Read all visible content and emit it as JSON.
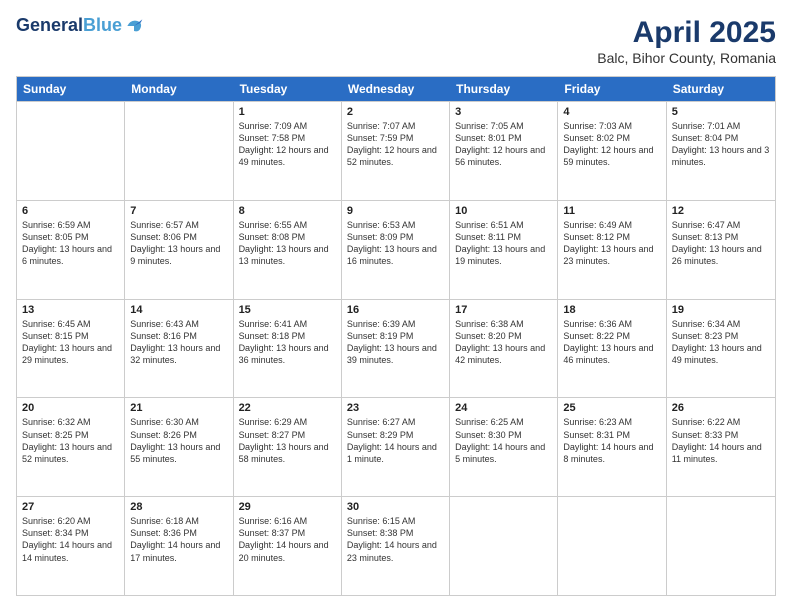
{
  "header": {
    "logo_line1": "General",
    "logo_line2": "Blue",
    "month_title": "April 2025",
    "location": "Balc, Bihor County, Romania"
  },
  "days_of_week": [
    "Sunday",
    "Monday",
    "Tuesday",
    "Wednesday",
    "Thursday",
    "Friday",
    "Saturday"
  ],
  "weeks": [
    [
      {
        "num": "",
        "sunrise": "",
        "sunset": "",
        "daylight": ""
      },
      {
        "num": "",
        "sunrise": "",
        "sunset": "",
        "daylight": ""
      },
      {
        "num": "1",
        "sunrise": "Sunrise: 7:09 AM",
        "sunset": "Sunset: 7:58 PM",
        "daylight": "Daylight: 12 hours and 49 minutes."
      },
      {
        "num": "2",
        "sunrise": "Sunrise: 7:07 AM",
        "sunset": "Sunset: 7:59 PM",
        "daylight": "Daylight: 12 hours and 52 minutes."
      },
      {
        "num": "3",
        "sunrise": "Sunrise: 7:05 AM",
        "sunset": "Sunset: 8:01 PM",
        "daylight": "Daylight: 12 hours and 56 minutes."
      },
      {
        "num": "4",
        "sunrise": "Sunrise: 7:03 AM",
        "sunset": "Sunset: 8:02 PM",
        "daylight": "Daylight: 12 hours and 59 minutes."
      },
      {
        "num": "5",
        "sunrise": "Sunrise: 7:01 AM",
        "sunset": "Sunset: 8:04 PM",
        "daylight": "Daylight: 13 hours and 3 minutes."
      }
    ],
    [
      {
        "num": "6",
        "sunrise": "Sunrise: 6:59 AM",
        "sunset": "Sunset: 8:05 PM",
        "daylight": "Daylight: 13 hours and 6 minutes."
      },
      {
        "num": "7",
        "sunrise": "Sunrise: 6:57 AM",
        "sunset": "Sunset: 8:06 PM",
        "daylight": "Daylight: 13 hours and 9 minutes."
      },
      {
        "num": "8",
        "sunrise": "Sunrise: 6:55 AM",
        "sunset": "Sunset: 8:08 PM",
        "daylight": "Daylight: 13 hours and 13 minutes."
      },
      {
        "num": "9",
        "sunrise": "Sunrise: 6:53 AM",
        "sunset": "Sunset: 8:09 PM",
        "daylight": "Daylight: 13 hours and 16 minutes."
      },
      {
        "num": "10",
        "sunrise": "Sunrise: 6:51 AM",
        "sunset": "Sunset: 8:11 PM",
        "daylight": "Daylight: 13 hours and 19 minutes."
      },
      {
        "num": "11",
        "sunrise": "Sunrise: 6:49 AM",
        "sunset": "Sunset: 8:12 PM",
        "daylight": "Daylight: 13 hours and 23 minutes."
      },
      {
        "num": "12",
        "sunrise": "Sunrise: 6:47 AM",
        "sunset": "Sunset: 8:13 PM",
        "daylight": "Daylight: 13 hours and 26 minutes."
      }
    ],
    [
      {
        "num": "13",
        "sunrise": "Sunrise: 6:45 AM",
        "sunset": "Sunset: 8:15 PM",
        "daylight": "Daylight: 13 hours and 29 minutes."
      },
      {
        "num": "14",
        "sunrise": "Sunrise: 6:43 AM",
        "sunset": "Sunset: 8:16 PM",
        "daylight": "Daylight: 13 hours and 32 minutes."
      },
      {
        "num": "15",
        "sunrise": "Sunrise: 6:41 AM",
        "sunset": "Sunset: 8:18 PM",
        "daylight": "Daylight: 13 hours and 36 minutes."
      },
      {
        "num": "16",
        "sunrise": "Sunrise: 6:39 AM",
        "sunset": "Sunset: 8:19 PM",
        "daylight": "Daylight: 13 hours and 39 minutes."
      },
      {
        "num": "17",
        "sunrise": "Sunrise: 6:38 AM",
        "sunset": "Sunset: 8:20 PM",
        "daylight": "Daylight: 13 hours and 42 minutes."
      },
      {
        "num": "18",
        "sunrise": "Sunrise: 6:36 AM",
        "sunset": "Sunset: 8:22 PM",
        "daylight": "Daylight: 13 hours and 46 minutes."
      },
      {
        "num": "19",
        "sunrise": "Sunrise: 6:34 AM",
        "sunset": "Sunset: 8:23 PM",
        "daylight": "Daylight: 13 hours and 49 minutes."
      }
    ],
    [
      {
        "num": "20",
        "sunrise": "Sunrise: 6:32 AM",
        "sunset": "Sunset: 8:25 PM",
        "daylight": "Daylight: 13 hours and 52 minutes."
      },
      {
        "num": "21",
        "sunrise": "Sunrise: 6:30 AM",
        "sunset": "Sunset: 8:26 PM",
        "daylight": "Daylight: 13 hours and 55 minutes."
      },
      {
        "num": "22",
        "sunrise": "Sunrise: 6:29 AM",
        "sunset": "Sunset: 8:27 PM",
        "daylight": "Daylight: 13 hours and 58 minutes."
      },
      {
        "num": "23",
        "sunrise": "Sunrise: 6:27 AM",
        "sunset": "Sunset: 8:29 PM",
        "daylight": "Daylight: 14 hours and 1 minute."
      },
      {
        "num": "24",
        "sunrise": "Sunrise: 6:25 AM",
        "sunset": "Sunset: 8:30 PM",
        "daylight": "Daylight: 14 hours and 5 minutes."
      },
      {
        "num": "25",
        "sunrise": "Sunrise: 6:23 AM",
        "sunset": "Sunset: 8:31 PM",
        "daylight": "Daylight: 14 hours and 8 minutes."
      },
      {
        "num": "26",
        "sunrise": "Sunrise: 6:22 AM",
        "sunset": "Sunset: 8:33 PM",
        "daylight": "Daylight: 14 hours and 11 minutes."
      }
    ],
    [
      {
        "num": "27",
        "sunrise": "Sunrise: 6:20 AM",
        "sunset": "Sunset: 8:34 PM",
        "daylight": "Daylight: 14 hours and 14 minutes."
      },
      {
        "num": "28",
        "sunrise": "Sunrise: 6:18 AM",
        "sunset": "Sunset: 8:36 PM",
        "daylight": "Daylight: 14 hours and 17 minutes."
      },
      {
        "num": "29",
        "sunrise": "Sunrise: 6:16 AM",
        "sunset": "Sunset: 8:37 PM",
        "daylight": "Daylight: 14 hours and 20 minutes."
      },
      {
        "num": "30",
        "sunrise": "Sunrise: 6:15 AM",
        "sunset": "Sunset: 8:38 PM",
        "daylight": "Daylight: 14 hours and 23 minutes."
      },
      {
        "num": "",
        "sunrise": "",
        "sunset": "",
        "daylight": ""
      },
      {
        "num": "",
        "sunrise": "",
        "sunset": "",
        "daylight": ""
      },
      {
        "num": "",
        "sunrise": "",
        "sunset": "",
        "daylight": ""
      }
    ]
  ]
}
